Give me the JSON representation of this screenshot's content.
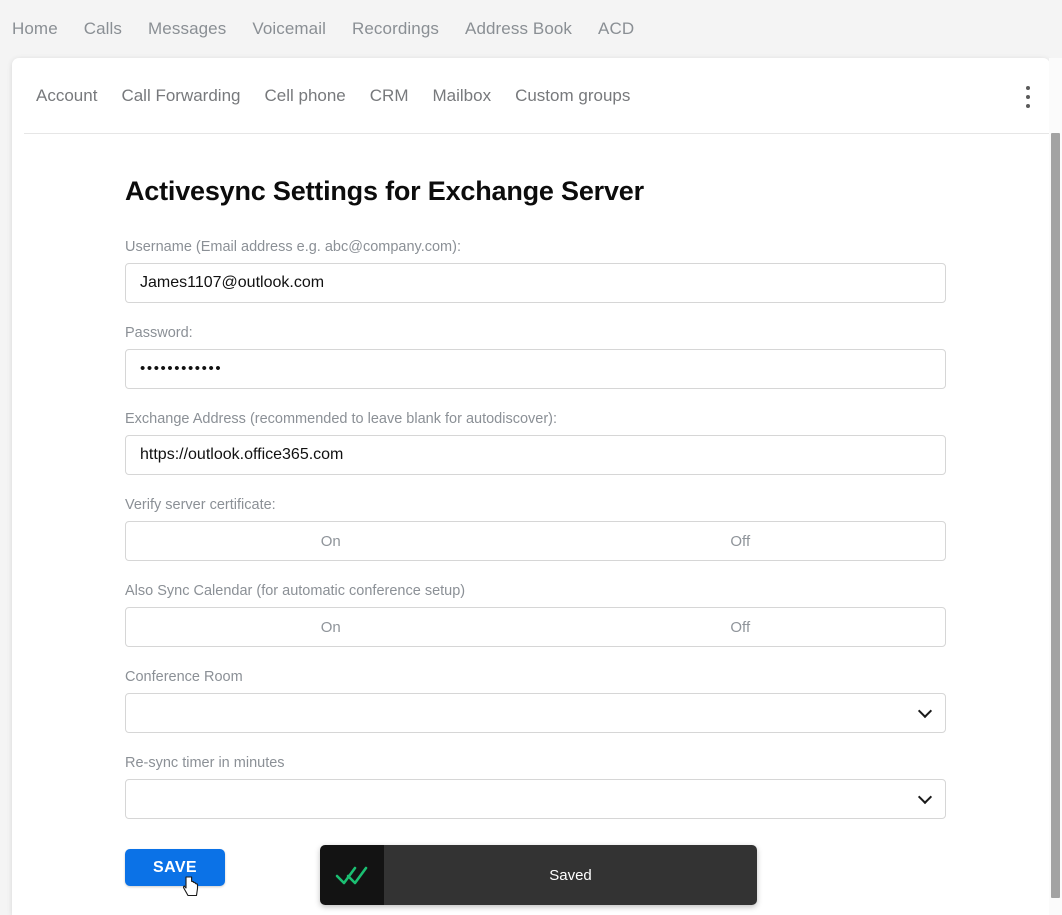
{
  "topnav": {
    "items": [
      {
        "label": "Home"
      },
      {
        "label": "Calls"
      },
      {
        "label": "Messages"
      },
      {
        "label": "Voicemail"
      },
      {
        "label": "Recordings"
      },
      {
        "label": "Address Book"
      },
      {
        "label": "ACD"
      }
    ]
  },
  "tabs": {
    "items": [
      {
        "label": "Account"
      },
      {
        "label": "Call Forwarding"
      },
      {
        "label": "Cell phone"
      },
      {
        "label": "CRM"
      },
      {
        "label": "Mailbox"
      },
      {
        "label": "Custom groups"
      }
    ],
    "overflow_menu_icon": "kebab-vertical-icon"
  },
  "main": {
    "title": "Activesync Settings for Exchange Server",
    "fields": {
      "username": {
        "label": "Username (Email address e.g. abc@company.com):",
        "value": "James1107@outlook.com",
        "placeholder": ""
      },
      "password": {
        "label": "Password:",
        "value": "••••••••••••",
        "placeholder": ""
      },
      "exchange_address": {
        "label": "Exchange Address (recommended to leave blank for autodiscover):",
        "value": "https://outlook.office365.com",
        "placeholder": ""
      },
      "verify_certificate": {
        "label": "Verify server certificate:",
        "on_label": "On",
        "off_label": "Off",
        "selected": ""
      },
      "sync_calendar": {
        "label": "Also Sync Calendar (for automatic conference setup)",
        "on_label": "On",
        "off_label": "Off",
        "selected": ""
      },
      "conference_room": {
        "label": "Conference Room",
        "value": "",
        "caret_icon": "chevron-down-icon"
      },
      "resync_timer": {
        "label": "Re-sync timer in minutes",
        "value": "",
        "caret_icon": "chevron-down-icon"
      }
    },
    "save_label": "SAVE"
  },
  "toast": {
    "message": "Saved",
    "icon": "double-check-icon",
    "icon_color": "#1bbf72",
    "icon_panel_color": "#131313",
    "body_color": "#333333"
  },
  "colors": {
    "accent_blue": "#0b72e7",
    "page_background": "#f4f4f4",
    "card_background": "#ffffff",
    "label_gray": "#8b9096",
    "border_gray": "#d6d6d6"
  }
}
